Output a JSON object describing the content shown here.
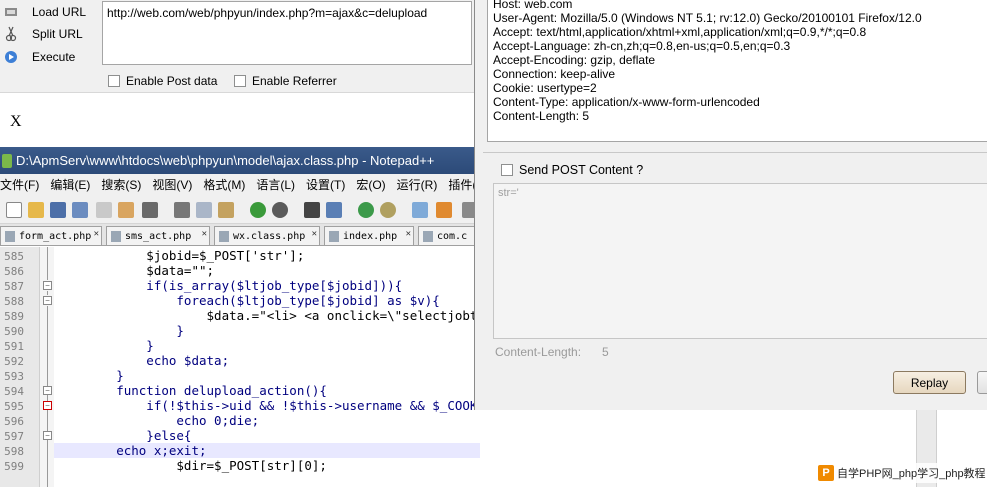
{
  "hackbar": {
    "load_url_label": "Load URL",
    "split_url_label": "Split URL",
    "execute_label": "Execute",
    "url_value": "http://web.com/web/phpyun/index.php?m=ajax&c=delupload",
    "enable_post_label": "Enable Post data",
    "enable_referrer_label": "Enable Referrer"
  },
  "page": {
    "content": "X"
  },
  "editor": {
    "title": "D:\\ApmServ\\www\\htdocs\\web\\phpyun\\model\\ajax.class.php - Notepad++",
    "menu": [
      "文件(F)",
      "编辑(E)",
      "搜索(S)",
      "视图(V)",
      "格式(M)",
      "语言(L)",
      "设置(T)",
      "宏(O)",
      "运行(R)",
      "插件(P)"
    ],
    "tabs": [
      "form_act.php",
      "sms_act.php",
      "wx.class.php",
      "index.php",
      "com.c"
    ],
    "line_numbers": [
      "585",
      "586",
      "587",
      "588",
      "589",
      "590",
      "591",
      "592",
      "593",
      "594",
      "595",
      "596",
      "597",
      "598",
      "599"
    ],
    "lines": [
      "            $jobid=$_POST['str'];",
      "            $data=\"\";",
      "            if(is_array($ltjob_type[$jobid])){",
      "                foreach($ltjob_type[$jobid] as $v){",
      "                    $data.=\"<li> <a onclick=\\\"selectjobt",
      "                }",
      "            }",
      "            echo $data;",
      "        }",
      "        function delupload_action(){",
      "            if(!$this->uid && !$this->username && $_COOKI",
      "                echo 0;die;",
      "            }else{",
      "        echo x;exit;",
      "                $dir=$_POST[str][0];"
    ]
  },
  "dialog": {
    "headers": [
      "Host: web.com",
      "User-Agent: Mozilla/5.0 (Windows NT 5.1; rv:12.0) Gecko/20100101 Firefox/12.0",
      "Accept: text/html,application/xhtml+xml,application/xml;q=0.9,*/*;q=0.8",
      "Accept-Language: zh-cn,zh;q=0.8,en-us;q=0.5,en;q=0.3",
      "Accept-Encoding: gzip, deflate",
      "Connection: keep-alive",
      "Cookie: usertype=2",
      "Content-Type: application/x-www-form-urlencoded",
      "Content-Length: 5"
    ],
    "send_post_label": "Send POST Content ?",
    "post_content": "str='",
    "content_length_label": "Content-Length:",
    "content_length_value": "5",
    "replay_label": "Replay"
  },
  "watermark": {
    "logo": "P",
    "text": "自学PHP网_php学习_php教程"
  },
  "colors": {
    "title_bar": "#2c4a78",
    "keyword": "#00007f",
    "string": "#7f007f",
    "replay_button": "#e6d7bf"
  }
}
